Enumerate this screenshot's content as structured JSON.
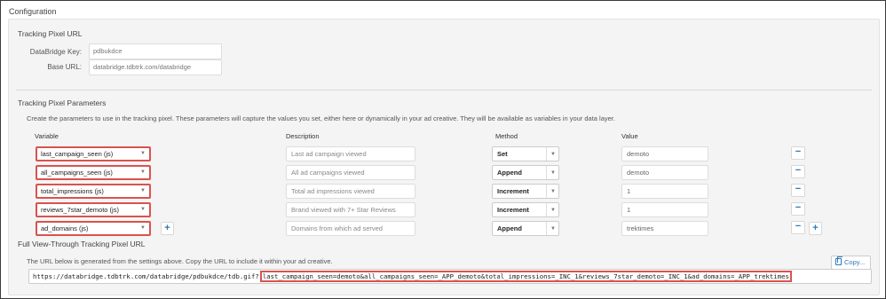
{
  "section_title": "Configuration",
  "tracking_pixel_url": {
    "title": "Tracking Pixel URL",
    "databridge_key_label": "DataBridge Key:",
    "databridge_key_value": "pdbukdce",
    "base_url_label": "Base URL:",
    "base_url_value": "databridge.tdbtrk.com/databridge"
  },
  "parameters": {
    "title": "Tracking Pixel Parameters",
    "instructions": "Create the parameters to use in the tracking pixel. These parameters will capture the values you set, either here or dynamically in your ad creative. They will be available as variables in your data layer.",
    "columns": {
      "variable": "Variable",
      "description": "Description",
      "method": "Method",
      "value": "Value"
    },
    "rows": [
      {
        "variable": "last_campaign_seen (js)",
        "description": "Last ad campaign viewed",
        "method": "Set",
        "value": "demoto"
      },
      {
        "variable": "all_campaigns_seen (js)",
        "description": "All ad campaigns viewed",
        "method": "Append",
        "value": "demoto"
      },
      {
        "variable": "total_impressions (js)",
        "description": "Total ad impressions viewed",
        "method": "Increment",
        "value": "1"
      },
      {
        "variable": "reviews_7star_demoto (js)",
        "description": "Brand viewed with 7+ Star Reviews",
        "method": "Increment",
        "value": "1"
      },
      {
        "variable": "ad_domains (js)",
        "description": "Domains from which ad served",
        "method": "Append",
        "value": "trektimes"
      }
    ],
    "remove_symbol": "−",
    "add_symbol": "+"
  },
  "full_url": {
    "title": "Full View-Through Tracking Pixel URL",
    "instructions": "The URL below is generated from the settings above. Copy the URL to include it within your ad creative.",
    "copy_label": "Copy...",
    "url_base": "https://databridge.tdbtrk.com/databridge/pdbukdce/tdb.gif?",
    "url_query": "last_campaign_seen=demoto&all_campaigns_seen=_APP_demoto&total_impressions=_INC_1&reviews_7star_demoto=_INC_1&ad_domains=_APP_trektimes"
  },
  "icons": {
    "dropdown": "chevron-down-icon",
    "copy": "copy-icon",
    "remove": "minus-icon",
    "add": "plus-icon"
  },
  "colors": {
    "highlight": "#d9534f",
    "accent": "#2a7ab9",
    "panel_bg": "#f4f4f4"
  }
}
